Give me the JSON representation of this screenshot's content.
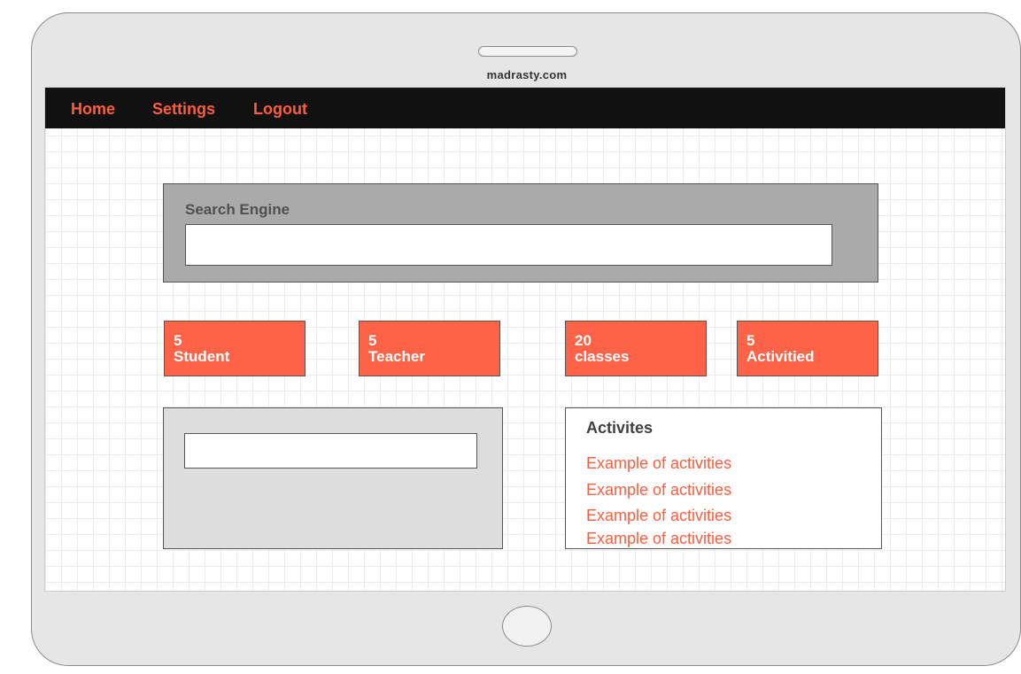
{
  "device": {
    "url": "madrasty.com"
  },
  "nav": {
    "items": [
      {
        "label": "Home"
      },
      {
        "label": "Settings"
      },
      {
        "label": "Logout"
      }
    ]
  },
  "search": {
    "title": "Search Engine",
    "placeholder": ""
  },
  "stats": [
    {
      "count": "5",
      "label": "Student"
    },
    {
      "count": "5",
      "label": "Teacher"
    },
    {
      "count": "20",
      "label": "classes"
    },
    {
      "count": "5",
      "label": "Activitied"
    }
  ],
  "activities": {
    "title": "Activites",
    "items": [
      "Example of activities",
      "Example of activities",
      "Example of activities",
      "Example of activities"
    ]
  },
  "colors": {
    "accent": "#ff6347",
    "nav_bg": "#111111",
    "search_panel_bg": "#aaaaaa"
  }
}
